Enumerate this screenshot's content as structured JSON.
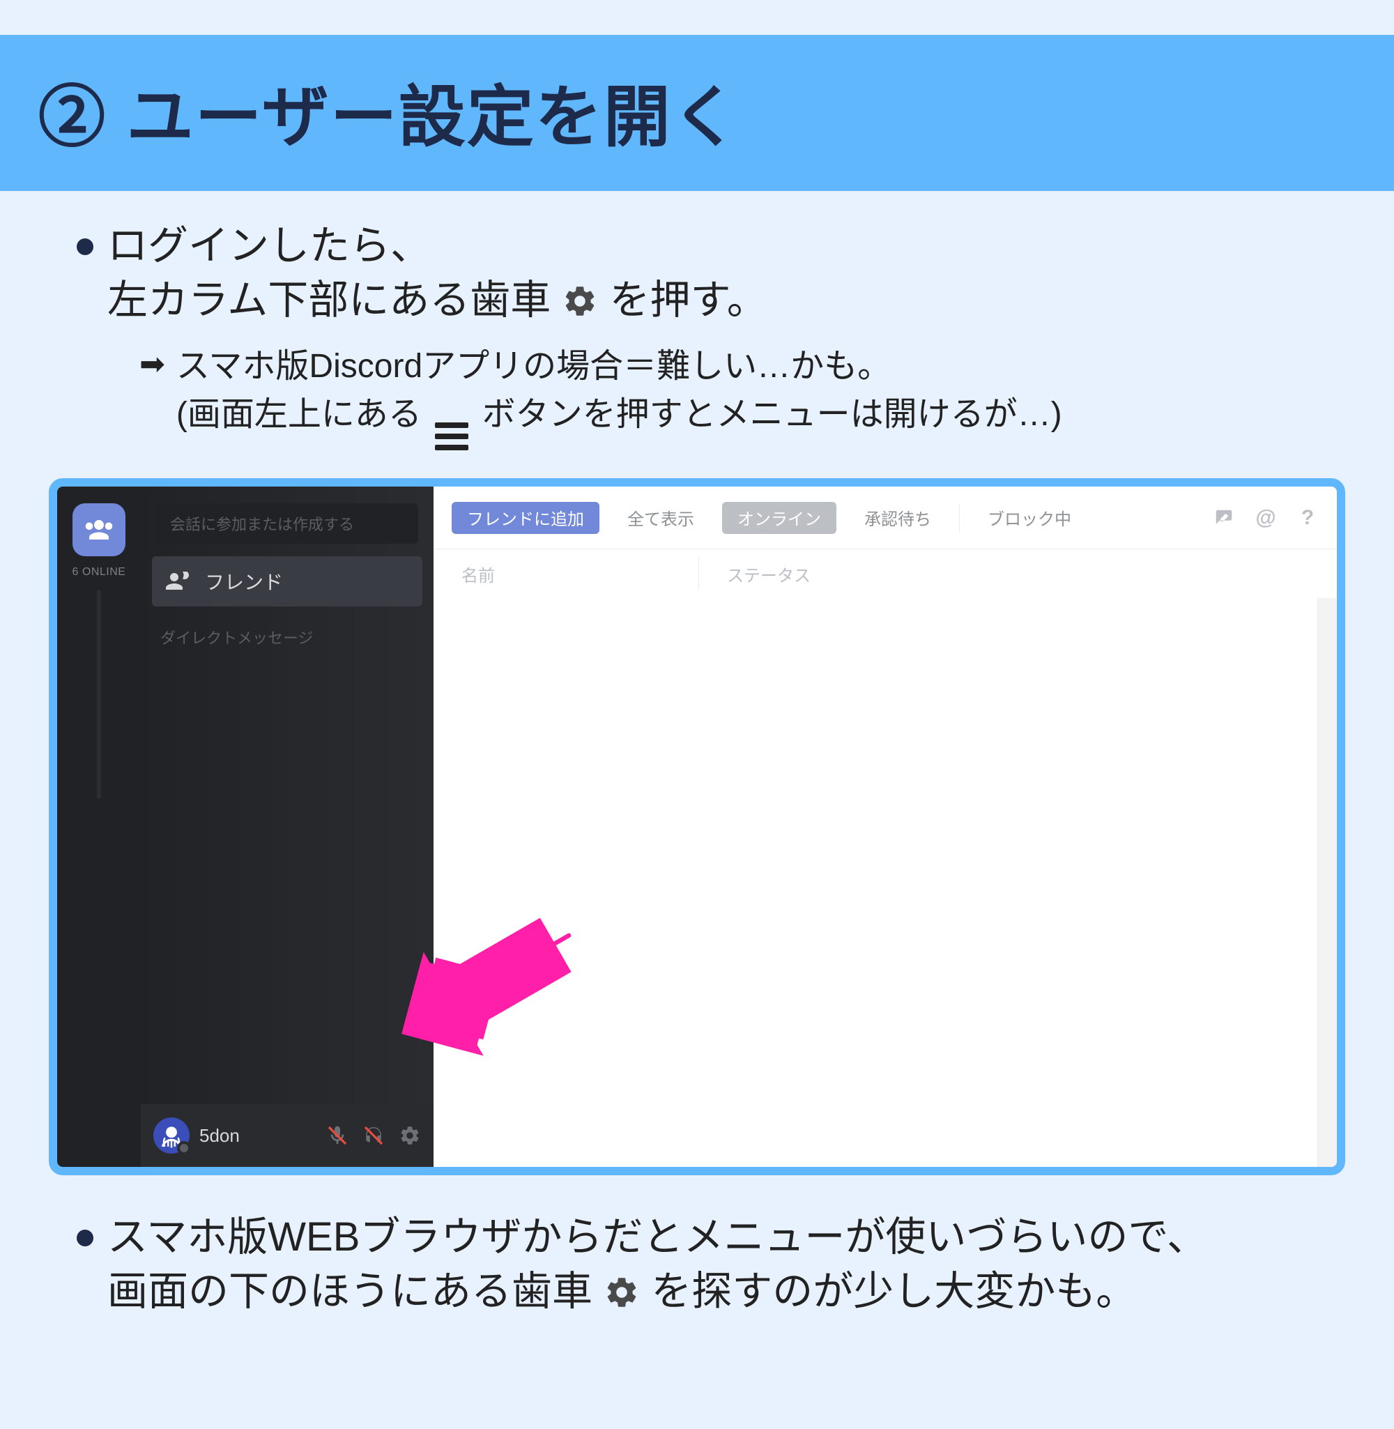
{
  "header": {
    "title": "② ユーザー設定を開く"
  },
  "bullet1": {
    "line1": "ログインしたら、",
    "line2a": "左カラム下部にある歯車",
    "line2b": "を押す。"
  },
  "sub1": {
    "line1": "スマホ版Discordアプリの場合＝難しい…かも。",
    "line2a": "(画面左上にある",
    "line2b": "ボタンを押すとメニューは開けるが…)"
  },
  "discord": {
    "online_count": "6 ONLINE",
    "search_placeholder": "会話に参加または作成する",
    "friends_label": "フレンド",
    "dm_label": "ダイレクトメッセージ",
    "username": "5don",
    "tabs": {
      "add": "フレンドに追加",
      "all": "全て表示",
      "online": "オンライン",
      "pending": "承認待ち",
      "blocked": "ブロック中"
    },
    "columns": {
      "name": "名前",
      "status": "ステータス"
    }
  },
  "bullet2": {
    "line1": "スマホ版WEBブラウザからだとメニューが使いづらいので、",
    "line2a": "画面の下のほうにある歯車",
    "line2b": "を探すのが少し大変かも。"
  }
}
